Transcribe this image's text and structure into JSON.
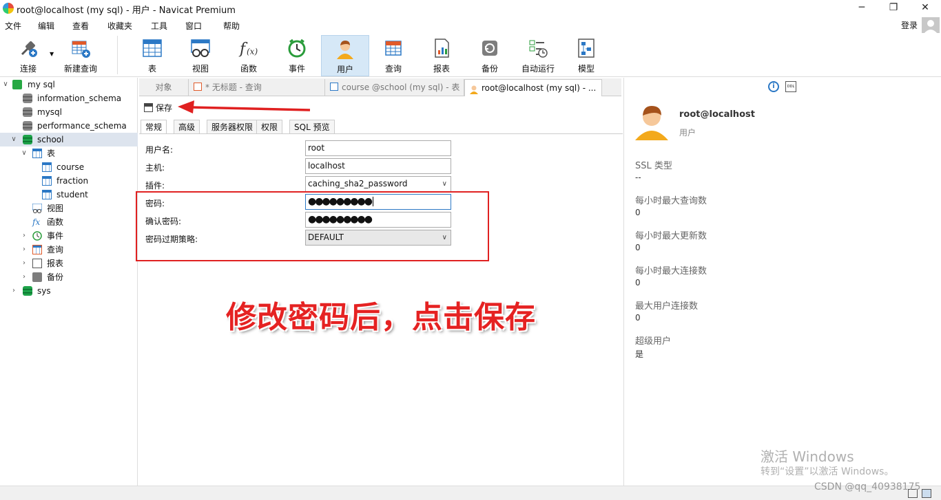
{
  "window": {
    "title": "root@localhost (my sql) - 用户 - Navicat Premium",
    "minimize": "─",
    "maximize": "❐",
    "close": "✕"
  },
  "menu": [
    "文件",
    "编辑",
    "查看",
    "收藏夹",
    "工具",
    "窗口",
    "帮助"
  ],
  "login_label": "登录",
  "toolbar": [
    {
      "label": "连接",
      "icon": "plug-icon"
    },
    {
      "label": "新建查询",
      "icon": "new-query-icon"
    },
    {
      "label": "表",
      "icon": "table-icon"
    },
    {
      "label": "视图",
      "icon": "view-icon"
    },
    {
      "label": "函数",
      "icon": "function-icon"
    },
    {
      "label": "事件",
      "icon": "clock-icon"
    },
    {
      "label": "用户",
      "icon": "user-icon",
      "active": true
    },
    {
      "label": "查询",
      "icon": "query-icon"
    },
    {
      "label": "报表",
      "icon": "report-icon"
    },
    {
      "label": "备份",
      "icon": "backup-icon"
    },
    {
      "label": "自动运行",
      "icon": "automation-icon"
    },
    {
      "label": "模型",
      "icon": "model-icon"
    }
  ],
  "tree": {
    "connection": "my sql",
    "databases": [
      "information_schema",
      "mysql",
      "performance_schema",
      "school",
      "sys"
    ],
    "school_children": {
      "tables_label": "表",
      "tables": [
        "course",
        "fraction",
        "student"
      ],
      "others": [
        "视图",
        "函数",
        "事件",
        "查询",
        "报表",
        "备份"
      ]
    }
  },
  "tabs": [
    "对象",
    "* 无标题 - 查询",
    "course @school (my sql) - 表",
    "root@localhost (my sql) - ..."
  ],
  "editor": {
    "save_label": "保存",
    "subtabs": [
      "常规",
      "高级",
      "服务器权限",
      "权限",
      "SQL 预览"
    ],
    "fields": {
      "username_label": "用户名:",
      "username_value": "root",
      "host_label": "主机:",
      "host_value": "localhost",
      "plugin_label": "插件:",
      "plugin_value": "caching_sha2_password",
      "password_label": "密码:",
      "password_value": "●●●●●●●●●",
      "confirm_label": "确认密码:",
      "confirm_value": "●●●●●●●●●",
      "expire_label": "密码过期策略:",
      "expire_value": "DEFAULT"
    },
    "annotation": "修改密码后，点击保存"
  },
  "info_panel": {
    "user": "root@localhost",
    "type": "用户",
    "ssl_label": "SSL 类型",
    "ssl_value": "--",
    "max_queries_label": "每小时最大查询数",
    "max_queries_value": "0",
    "max_updates_label": "每小时最大更新数",
    "max_updates_value": "0",
    "max_conn_label": "每小时最大连接数",
    "max_conn_value": "0",
    "max_user_conn_label": "最大用户连接数",
    "max_user_conn_value": "0",
    "superuser_label": "超级用户",
    "superuser_value": "是",
    "info_glyph": "i",
    "ddl_glyph": "DDL"
  },
  "os_overlay": {
    "activate_title": "激活 Windows",
    "activate_hint": "转到“设置”以激活 Windows。",
    "watermark": "CSDN @qq_40938175"
  }
}
